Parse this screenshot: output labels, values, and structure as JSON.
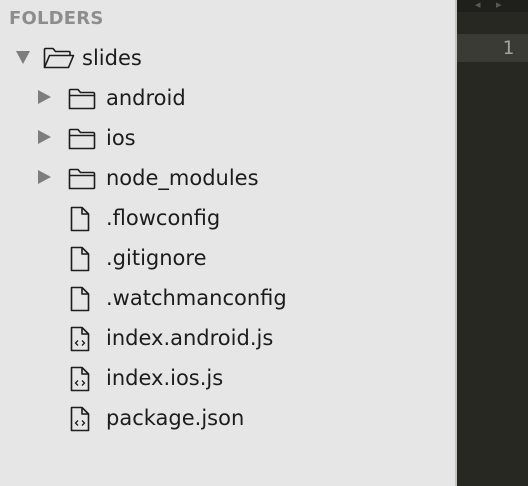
{
  "sidebar": {
    "header": "FOLDERS",
    "root": {
      "name": "slides",
      "expanded": true,
      "icon": "folder-open-icon"
    },
    "items": [
      {
        "name": "android",
        "type": "folder",
        "expanded": false,
        "icon": "folder-icon"
      },
      {
        "name": "ios",
        "type": "folder",
        "expanded": false,
        "icon": "folder-icon"
      },
      {
        "name": "node_modules",
        "type": "folder",
        "expanded": false,
        "icon": "folder-icon"
      },
      {
        "name": ".flowconfig",
        "type": "file",
        "icon": "file-icon"
      },
      {
        "name": ".gitignore",
        "type": "file",
        "icon": "file-icon"
      },
      {
        "name": ".watchmanconfig",
        "type": "file",
        "icon": "file-icon"
      },
      {
        "name": "index.android.js",
        "type": "code-file",
        "icon": "code-file-icon"
      },
      {
        "name": "index.ios.js",
        "type": "code-file",
        "icon": "code-file-icon"
      },
      {
        "name": "package.json",
        "type": "code-file",
        "icon": "code-file-icon"
      }
    ]
  },
  "editor": {
    "line_number": "1",
    "tab_nav_glyphs": "◂ ▸"
  },
  "colors": {
    "sidebar_bg": "#e6e6e6",
    "editor_bg": "#272822",
    "gutter_highlight": "#3a3b35",
    "header_text": "#8d8d8d"
  }
}
